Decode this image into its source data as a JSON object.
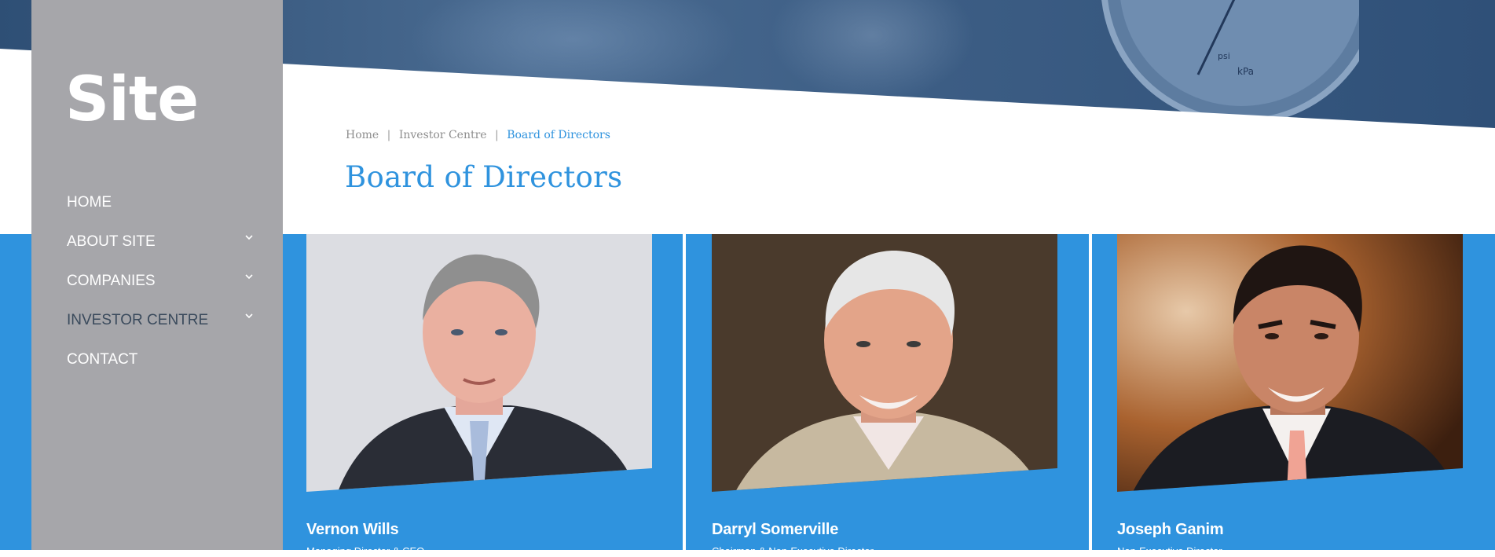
{
  "logo": {
    "text": "Site"
  },
  "nav": {
    "items": [
      {
        "label": "HOME",
        "has_submenu": false
      },
      {
        "label": "ABOUT SITE",
        "has_submenu": true
      },
      {
        "label": "COMPANIES",
        "has_submenu": true
      },
      {
        "label": "INVESTOR CENTRE",
        "has_submenu": true,
        "active": true
      },
      {
        "label": "CONTACT",
        "has_submenu": false
      }
    ]
  },
  "breadcrumb": {
    "items": [
      "Home",
      "Investor Centre"
    ],
    "current": "Board of Directors",
    "separator": "|"
  },
  "page_title": "Board of Directors",
  "directors": [
    {
      "name": "Vernon Wills",
      "role": "Managing Director & CEO"
    },
    {
      "name": "Darryl Somerville",
      "role": "Chairman & Non-Executive Director"
    },
    {
      "name": "Joseph Ganim",
      "role": "Non-Executive Director"
    }
  ],
  "colors": {
    "accent_blue": "#2f93de",
    "sidebar_gray": "#a6a6aa",
    "hero_navy": "#2e4f75",
    "active_nav": "#3a4a5c"
  }
}
